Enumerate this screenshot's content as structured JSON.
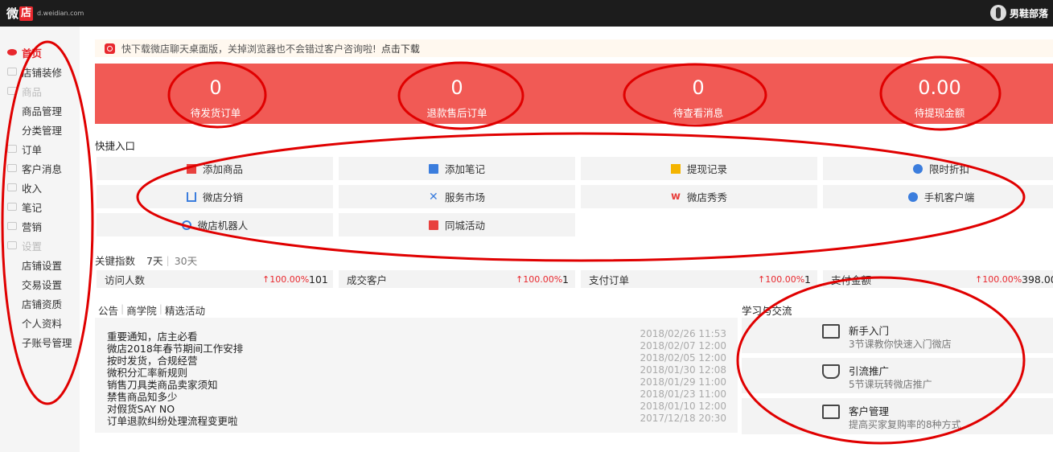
{
  "header": {
    "logo_word": "微",
    "logo_box": "店",
    "logo_url": "d.weidian.com",
    "shop_name": "男鞋部落"
  },
  "sidebar": {
    "items": [
      {
        "label": "首页",
        "icon": "eye-icon"
      },
      {
        "label": "店铺装修",
        "icon": "shop-icon"
      },
      {
        "label": "商品",
        "icon": "goods-icon"
      },
      {
        "label": "商品管理"
      },
      {
        "label": "分类管理"
      },
      {
        "label": "订单",
        "icon": "order-icon"
      },
      {
        "label": "客户消息",
        "icon": "message-icon"
      },
      {
        "label": "收入",
        "icon": "wallet-icon"
      },
      {
        "label": "笔记",
        "icon": "note-icon"
      },
      {
        "label": "营销",
        "icon": "marketing-icon"
      },
      {
        "label": "设置",
        "icon": "gear-icon"
      },
      {
        "label": "店铺设置"
      },
      {
        "label": "交易设置"
      },
      {
        "label": "店铺资质"
      },
      {
        "label": "个人资料"
      },
      {
        "label": "子账号管理"
      }
    ]
  },
  "notice": {
    "text": "快下载微店聊天桌面版，关掉浏览器也不会错过客户咨询啦!",
    "link": "点击下载"
  },
  "stats": [
    {
      "value": "0",
      "label": "待发货订单"
    },
    {
      "value": "0",
      "label": "退款售后订单"
    },
    {
      "value": "0",
      "label": "待查看消息"
    },
    {
      "value": "0.00",
      "label": "待提现金额"
    }
  ],
  "quick": {
    "title": "快捷入口",
    "items": [
      {
        "label": "添加商品",
        "icon": "add-goods-icon",
        "color": "#e8413e"
      },
      {
        "label": "添加笔记",
        "icon": "note-icon",
        "color": "#3b7ddd"
      },
      {
        "label": "提现记录",
        "icon": "withdraw-icon",
        "color": "#f4b400"
      },
      {
        "label": "限时折扣",
        "icon": "clock-icon",
        "color": "#3b7ddd"
      },
      {
        "label": "微店分销",
        "icon": "distribution-icon",
        "color": "#3b7ddd"
      },
      {
        "label": "服务市场",
        "icon": "tools-icon",
        "color": "#3b7ddd"
      },
      {
        "label": "微店秀秀",
        "icon": "xiuxiu-icon",
        "color": "#e8413e"
      },
      {
        "label": "手机客户端",
        "icon": "download-icon",
        "color": "#3b7ddd"
      },
      {
        "label": "微店机器人",
        "icon": "robot-icon",
        "color": "#3b7ddd"
      },
      {
        "label": "同城活动",
        "icon": "gift-icon",
        "color": "#e8413e"
      }
    ]
  },
  "kpi": {
    "title": "关键指数",
    "range_7": "7天",
    "range_30": "30天",
    "items": [
      {
        "label": "访问人数",
        "pct": "↑100.00%",
        "value": "101"
      },
      {
        "label": "成交客户",
        "pct": "↑100.00%",
        "value": "1"
      },
      {
        "label": "支付订单",
        "pct": "↑100.00%",
        "value": "1"
      },
      {
        "label": "支付金额",
        "pct": "↑100.00%",
        "value": "398.00"
      }
    ]
  },
  "news": {
    "tabs": [
      "公告",
      "商学院",
      "精选活动"
    ],
    "rows": [
      {
        "title": "重要通知，店主必看",
        "date": "2018/02/26 11:53"
      },
      {
        "title": "微店2018年春节期间工作安排",
        "date": "2018/02/07 12:00"
      },
      {
        "title": "按时发货，合规经营",
        "date": "2018/02/05 12:00"
      },
      {
        "title": "微积分汇率新规则",
        "date": "2018/01/30 12:08"
      },
      {
        "title": "销售刀具类商品卖家须知",
        "date": "2018/01/29 11:00"
      },
      {
        "title": "禁售商品知多少",
        "date": "2018/01/23 11:00"
      },
      {
        "title": "对假货SAY NO",
        "date": "2018/01/10 12:00"
      },
      {
        "title": "订单退款纠纷处理流程变更啦",
        "date": "2017/12/18 20:30"
      }
    ]
  },
  "learn": {
    "title": "学习与交流",
    "items": [
      {
        "title": "新手入门",
        "sub": "3节课教你快速入门微店",
        "icon": "book-icon"
      },
      {
        "title": "引流推广",
        "sub": "5节课玩转微店推广",
        "icon": "shop-icon"
      },
      {
        "title": "客户管理",
        "sub": "提高买家复购率的8种方式",
        "icon": "monitor-icon"
      }
    ]
  },
  "annotation_color": "#e00000"
}
